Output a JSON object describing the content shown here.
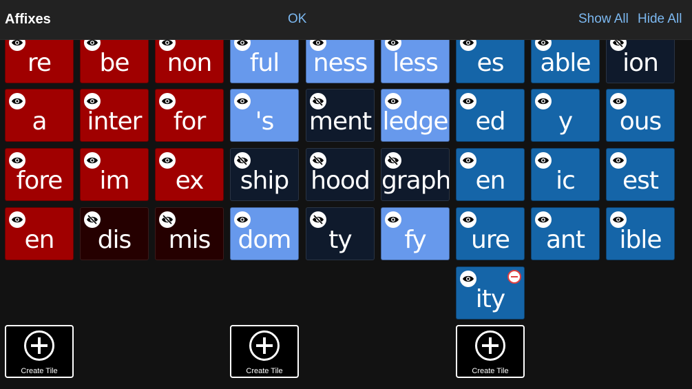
{
  "header": {
    "title": "Affixes",
    "ok_label": "OK",
    "show_all_label": "Show All",
    "hide_all_label": "Hide All"
  },
  "colors": {
    "prefix_visible": "#a00000",
    "prefix_hidden": "#250000",
    "suffix_group2_visible": "#6799ec",
    "suffix_group2_hidden": "#0f1a2c",
    "suffix_group3_visible": "#1565a8",
    "header_accent": "#7cb8f0"
  },
  "tiles": [
    {
      "word": "re",
      "group": "prefix",
      "visible": true
    },
    {
      "word": "be",
      "group": "prefix",
      "visible": true
    },
    {
      "word": "non",
      "group": "prefix",
      "visible": true
    },
    {
      "word": "ful",
      "group": "suffix2",
      "visible": true
    },
    {
      "word": "ness",
      "group": "suffix2",
      "visible": true
    },
    {
      "word": "less",
      "group": "suffix2",
      "visible": true
    },
    {
      "word": "es",
      "group": "suffix3",
      "visible": true
    },
    {
      "word": "able",
      "group": "suffix3",
      "visible": true
    },
    {
      "word": "ion",
      "group": "suffix3",
      "visible": false
    },
    {
      "word": "a",
      "group": "prefix",
      "visible": true
    },
    {
      "word": "inter",
      "group": "prefix",
      "visible": true
    },
    {
      "word": "for",
      "group": "prefix",
      "visible": true
    },
    {
      "word": "'s",
      "group": "suffix2",
      "visible": true
    },
    {
      "word": "ment",
      "group": "suffix2",
      "visible": false
    },
    {
      "word": "ledge",
      "group": "suffix2",
      "visible": true
    },
    {
      "word": "ed",
      "group": "suffix3",
      "visible": true
    },
    {
      "word": "y",
      "group": "suffix3",
      "visible": true
    },
    {
      "word": "ous",
      "group": "suffix3",
      "visible": true
    },
    {
      "word": "fore",
      "group": "prefix",
      "visible": true
    },
    {
      "word": "im",
      "group": "prefix",
      "visible": true
    },
    {
      "word": "ex",
      "group": "prefix",
      "visible": true
    },
    {
      "word": "ship",
      "group": "suffix2",
      "visible": false
    },
    {
      "word": "hood",
      "group": "suffix2",
      "visible": false
    },
    {
      "word": "graph",
      "group": "suffix2",
      "visible": false
    },
    {
      "word": "en",
      "group": "suffix3",
      "visible": true
    },
    {
      "word": "ic",
      "group": "suffix3",
      "visible": true
    },
    {
      "word": "est",
      "group": "suffix3",
      "visible": true
    },
    {
      "word": "en",
      "group": "prefix",
      "visible": true
    },
    {
      "word": "dis",
      "group": "prefix",
      "visible": false
    },
    {
      "word": "mis",
      "group": "prefix",
      "visible": false
    },
    {
      "word": "dom",
      "group": "suffix2",
      "visible": true
    },
    {
      "word": "ty",
      "group": "suffix2",
      "visible": false
    },
    {
      "word": "fy",
      "group": "suffix2",
      "visible": true
    },
    {
      "word": "ure",
      "group": "suffix3",
      "visible": true
    },
    {
      "word": "ant",
      "group": "suffix3",
      "visible": true
    },
    {
      "word": "ible",
      "group": "suffix3",
      "visible": true
    },
    {
      "word": "ity",
      "group": "suffix3",
      "visible": true,
      "removable": true
    }
  ],
  "create_tile_label": "Create Tile",
  "create_tiles": [
    "prefix",
    "suffix2",
    "suffix3"
  ]
}
